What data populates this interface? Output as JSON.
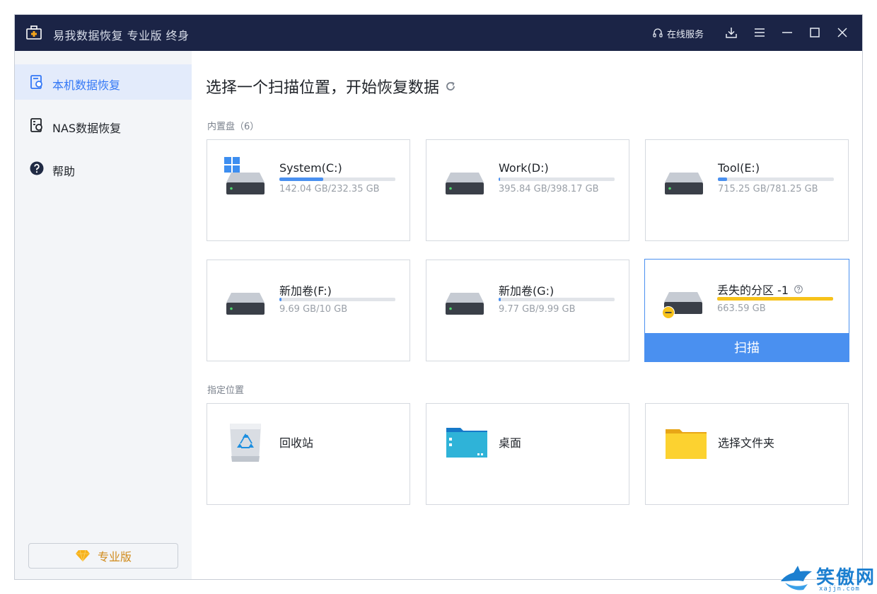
{
  "titlebar": {
    "app_title": "易我数据恢复 专业版 终身",
    "service_label": "在线服务",
    "icons": [
      "app-briefcase-icon",
      "headset-icon",
      "download-icon",
      "menu-icon",
      "minimize-icon",
      "maximize-icon",
      "close-icon"
    ]
  },
  "sidebar": {
    "items": [
      {
        "label": "本机数据恢复",
        "icon": "local-recovery-icon",
        "active": true
      },
      {
        "label": "NAS数据恢复",
        "icon": "nas-recovery-icon",
        "active": false
      },
      {
        "label": "帮助",
        "icon": "help-icon",
        "active": false
      }
    ],
    "pro_button_label": "专业版"
  },
  "main": {
    "title": "选择一个扫描位置，开始恢复数据",
    "internal_section_label": "内置盘（6）",
    "drives": [
      {
        "name": "System(C:)",
        "size": "142.04 GB/232.35 GB",
        "used_fraction": 0.38,
        "bar_color": "#4a90f0",
        "is_system": true
      },
      {
        "name": "Work(D:)",
        "size": "395.84 GB/398.17 GB",
        "used_fraction": 0.01,
        "bar_color": "#4a90f0"
      },
      {
        "name": "Tool(E:)",
        "size": "715.25 GB/781.25 GB",
        "used_fraction": 0.08,
        "bar_color": "#4a90f0"
      },
      {
        "name": "新加卷(F:)",
        "size": "9.69 GB/10 GB",
        "used_fraction": 0.02,
        "bar_color": "#4a90f0"
      },
      {
        "name": "新加卷(G:)",
        "size": "9.77 GB/9.99 GB",
        "used_fraction": 0.02,
        "bar_color": "#4a90f0"
      },
      {
        "name": "丢失的分区 -1",
        "size": "663.59 GB",
        "used_fraction": 1.0,
        "bar_color": "#f7c21a",
        "is_lost": true,
        "selected": true
      }
    ],
    "scan_button_label": "扫描",
    "location_section_label": "指定位置",
    "locations": [
      {
        "name": "回收站",
        "icon": "recycle-bin-icon"
      },
      {
        "name": "桌面",
        "icon": "desktop-folder-icon"
      },
      {
        "name": "选择文件夹",
        "icon": "folder-icon"
      }
    ]
  },
  "watermark": {
    "text": "笑傲网",
    "sub": "xajjn.com"
  },
  "colors": {
    "titlebar_bg": "#1b2446",
    "accent": "#4a90f0",
    "sidebar_bg": "#f3f5f8",
    "lost_bar": "#f7c21a",
    "pro_text": "#d08a1a"
  }
}
